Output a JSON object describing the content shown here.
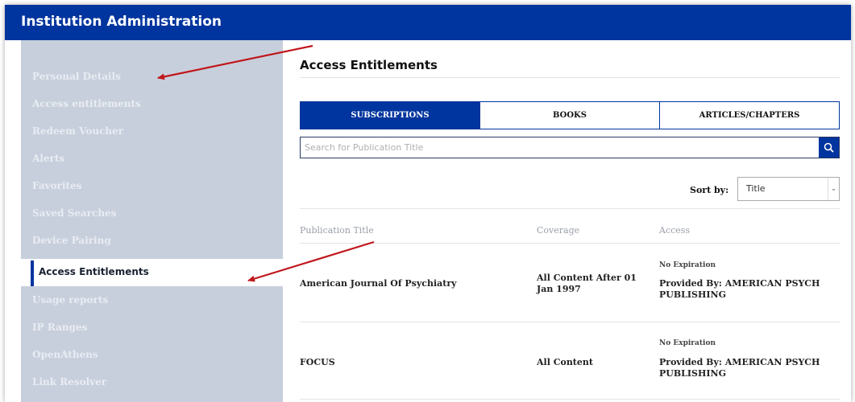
{
  "header": {
    "title": "Institution Administration"
  },
  "sidebar": {
    "items": [
      {
        "label": "Personal Details"
      },
      {
        "label": "Access entitlements"
      },
      {
        "label": "Redeem Voucher"
      },
      {
        "label": "Alerts"
      },
      {
        "label": "Favorites"
      },
      {
        "label": "Saved Searches"
      },
      {
        "label": "Device Pairing"
      },
      {
        "label": "Access Entitlements"
      },
      {
        "label": "Usage reports"
      },
      {
        "label": "IP Ranges"
      },
      {
        "label": "OpenAthens"
      },
      {
        "label": "Link Resolver"
      }
    ]
  },
  "main": {
    "title": "Access Entitlements",
    "tabs": [
      {
        "label": "SUBSCRIPTIONS"
      },
      {
        "label": "BOOKS"
      },
      {
        "label": "ARTICLES/CHAPTERS"
      }
    ],
    "search": {
      "placeholder": "Search for Publication Title"
    },
    "sort": {
      "label": "Sort by:",
      "value": "Title"
    },
    "table": {
      "headers": {
        "title": "Publication Title",
        "coverage": "Coverage",
        "access": "Access"
      },
      "rows": [
        {
          "title": "American Journal Of Psychiatry",
          "coverage": "All Content After 01 Jan 1997",
          "expiration": "No Expiration",
          "provider": "Provided By: AMERICAN PSYCH PUBLISHING"
        },
        {
          "title": "FOCUS",
          "coverage": "All Content",
          "expiration": "No Expiration",
          "provider": "Provided By: AMERICAN PSYCH PUBLISHING"
        }
      ]
    }
  },
  "colors": {
    "primary": "#00349e",
    "sidebar": "#c8cfdc",
    "annotation_arrow": "#c0171c"
  },
  "icons": {
    "search": "search-icon",
    "dropdown": "chevron-down-icon"
  }
}
